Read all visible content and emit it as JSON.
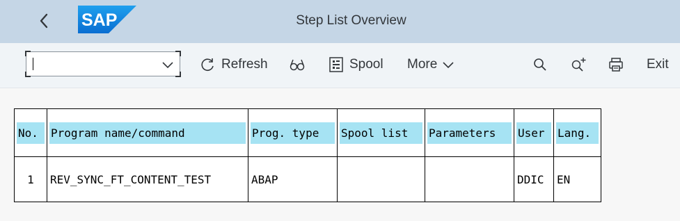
{
  "header": {
    "title": "Step List Overview",
    "logo_text": "SAP",
    "logo_color": "#1a7fd9"
  },
  "toolbar": {
    "command_field": {
      "value": "",
      "placeholder": ""
    },
    "refresh_label": "Refresh",
    "spool_label": "Spool",
    "more_label": "More",
    "exit_label": "Exit"
  },
  "table": {
    "columns": [
      "No.",
      "Program name/command",
      "Prog. type",
      "Spool list",
      "Parameters",
      "User",
      "Lang."
    ],
    "rows": [
      {
        "no": "1",
        "program": "REV_SYNC_FT_CONTENT_TEST",
        "prog_type": "ABAP",
        "spool_list": "",
        "parameters": "",
        "user": "DDIC",
        "lang": "EN"
      }
    ],
    "header_highlight_color": "#a6e3f3"
  }
}
